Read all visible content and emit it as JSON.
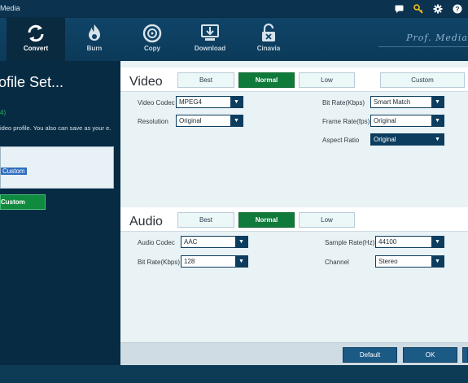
{
  "window": {
    "title": "Media"
  },
  "titlebar_icons": [
    "chat-icon",
    "key-icon",
    "gear-icon",
    "help-icon"
  ],
  "toolbar": {
    "items": [
      {
        "label": "Convert",
        "icon": "convert-icon",
        "active": true
      },
      {
        "label": "Burn",
        "icon": "burn-icon",
        "active": false
      },
      {
        "label": "Copy",
        "icon": "copy-icon",
        "active": false
      },
      {
        "label": "Download",
        "icon": "download-icon",
        "active": false
      },
      {
        "label": "Cinavia",
        "icon": "cinavia-icon",
        "active": false
      }
    ],
    "brand": "Prof. Media"
  },
  "left_panel": {
    "title": "ofile Set...",
    "count": "4)",
    "description": "ideo profile. You also can save as your e.",
    "selected_profile": "Custom",
    "button_label": "Custom"
  },
  "video": {
    "title": "Video",
    "presets": [
      "Best",
      "Normal",
      "Low",
      "Custom"
    ],
    "active_preset": "Normal",
    "fields": {
      "video_codec": {
        "label": "Video Codec",
        "value": "MPEG4"
      },
      "resolution": {
        "label": "Resolution",
        "value": "Original"
      },
      "bit_rate": {
        "label": "Bit Rate(Kbps)",
        "value": "Smart Match"
      },
      "frame_rate": {
        "label": "Frame Rate(fps)",
        "value": "Original"
      },
      "aspect_ratio": {
        "label": "Aspect Ratio",
        "value": "Original"
      }
    }
  },
  "audio": {
    "title": "Audio",
    "presets": [
      "Best",
      "Normal",
      "Low"
    ],
    "active_preset": "Normal",
    "fields": {
      "audio_codec": {
        "label": "Audio Codec",
        "value": "AAC"
      },
      "bit_rate": {
        "label": "Bit Rate(Kbps)",
        "value": "128"
      },
      "sample_rate": {
        "label": "Sample Rate(Hz)",
        "value": "44100"
      },
      "channel": {
        "label": "Channel",
        "value": "Stereo"
      }
    }
  },
  "footer": {
    "default_label": "Default",
    "ok_label": "OK"
  },
  "colors": {
    "accent_green": "#107a3a",
    "navy": "#0c3d5f",
    "panel_bg": "#e9f2f5"
  }
}
